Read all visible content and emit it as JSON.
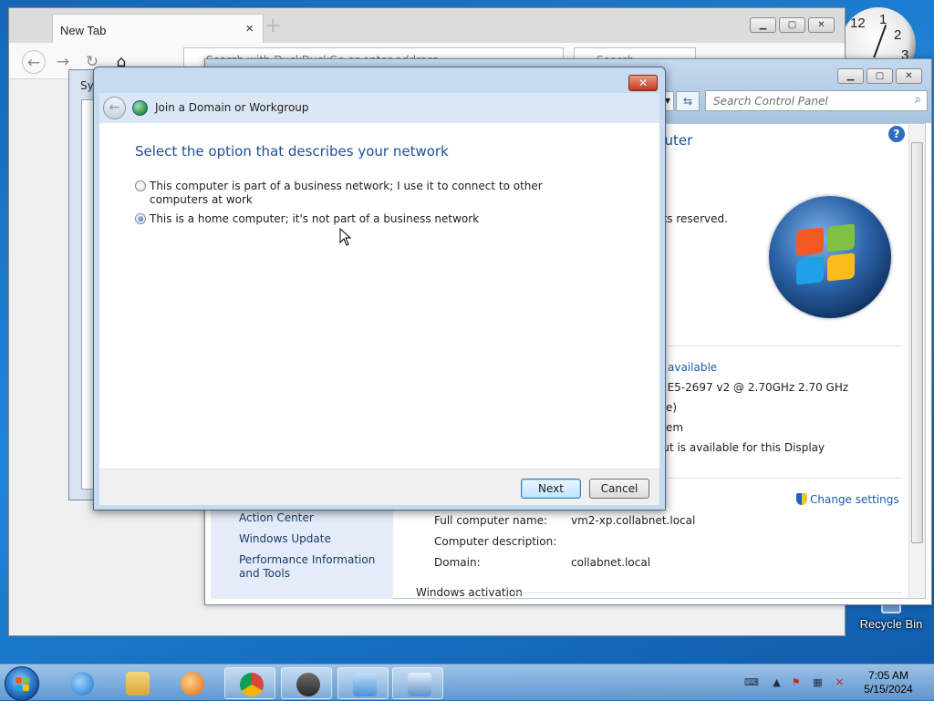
{
  "desktop": {
    "recycle_bin_label": "Recycle Bin",
    "clock_numerals": [
      "12",
      "1",
      "2",
      "3"
    ]
  },
  "browser": {
    "tab_title": "New Tab",
    "tab_close": "×",
    "new_tab": "+",
    "url_placeholder": "Search with DuckDuckGo or enter address",
    "search_placeholder": "Search"
  },
  "control_panel": {
    "search_placeholder": "Search Control Panel",
    "heading_partial": "puter",
    "copyright_partial": "hts reserved.",
    "rating_partial": "available",
    "processor_partial": "U E5-2697 v2 @ 2.70GHz  2.70 GHz",
    "memory_partial": "ble)",
    "system_type_partial": "stem",
    "pen_touch_partial": "out is available for this Display",
    "change_settings": "Change settings",
    "see_also": [
      "Action Center",
      "Windows Update",
      "Performance Information and Tools"
    ],
    "computer_fields": [
      {
        "label": "Full computer name:",
        "value": "vm2-xp.collabnet.local"
      },
      {
        "label": "Computer description:",
        "value": ""
      },
      {
        "label": "Domain:",
        "value": "collabnet.local"
      }
    ],
    "activation_heading": "Windows activation"
  },
  "system_properties": {
    "title_partial": "Sys"
  },
  "wizard": {
    "title": "Join a Domain or Workgroup",
    "prompt": "Select the option that describes your network",
    "options": [
      {
        "label": "This computer is part of a business network; I use it to connect to other computers at work",
        "selected": false
      },
      {
        "label": "This is a home computer; it's not part of a business network",
        "selected": true
      }
    ],
    "next_label": "Next",
    "cancel_label": "Cancel",
    "close_glyph": "✕"
  },
  "taskbar": {
    "time": "7:05 AM",
    "date": "5/15/2024"
  },
  "colors": {
    "heading_blue": "#1e4e99",
    "link_blue": "#1a5bb0",
    "close_red": "#c4381f"
  }
}
